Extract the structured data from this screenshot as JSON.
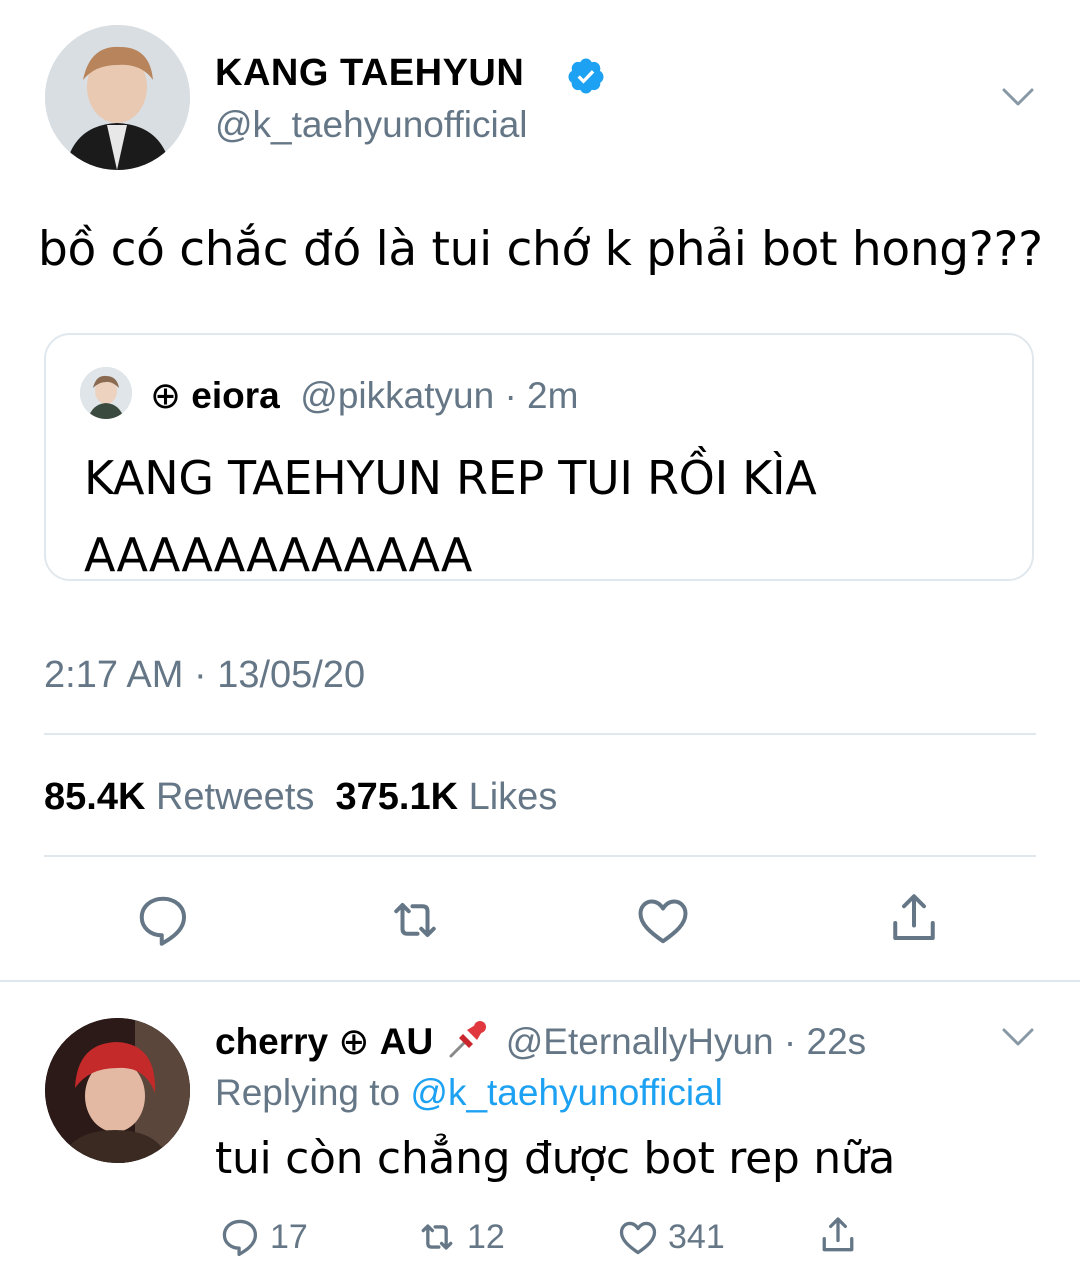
{
  "tweet": {
    "display_name": "KANG TAEHYUN",
    "handle": "@k_taehyunofficial",
    "text": "bồ có chắc đó là tui chớ k phải bot hong???",
    "timestamp": "2:17 AM · 13/05/20",
    "retweets_count": "85.4K",
    "retweets_label": "Retweets",
    "likes_count": "375.1K",
    "likes_label": "Likes"
  },
  "quote": {
    "symbol": "⊕",
    "name": "eiora",
    "handle_time": "@pikkatyun · 2m",
    "lines": [
      "KANG TAEHYUN REP TUI RỒI KÌA",
      "AAAAAAAAAAAA"
    ]
  },
  "reply": {
    "name_part1": "cherry",
    "symbol": "⊕",
    "name_part2": "AU",
    "handle_time": "@EternallyHyun · 22s",
    "replying_label": "Replying to",
    "replying_mention": "@k_taehyunofficial",
    "text": "tui còn chẳng được bot rep nữa",
    "reply_count": "17",
    "retweet_count": "12",
    "like_count": "341"
  },
  "colors": {
    "verified_blue": "#1da1f2",
    "secondary_text": "#657786",
    "divider": "#e1e8ed",
    "pin_red": "#e0383e"
  },
  "icons": [
    "verified-icon",
    "chevron-down-icon",
    "reply-icon",
    "retweet-icon",
    "heart-icon",
    "share-icon",
    "pushpin-icon"
  ]
}
